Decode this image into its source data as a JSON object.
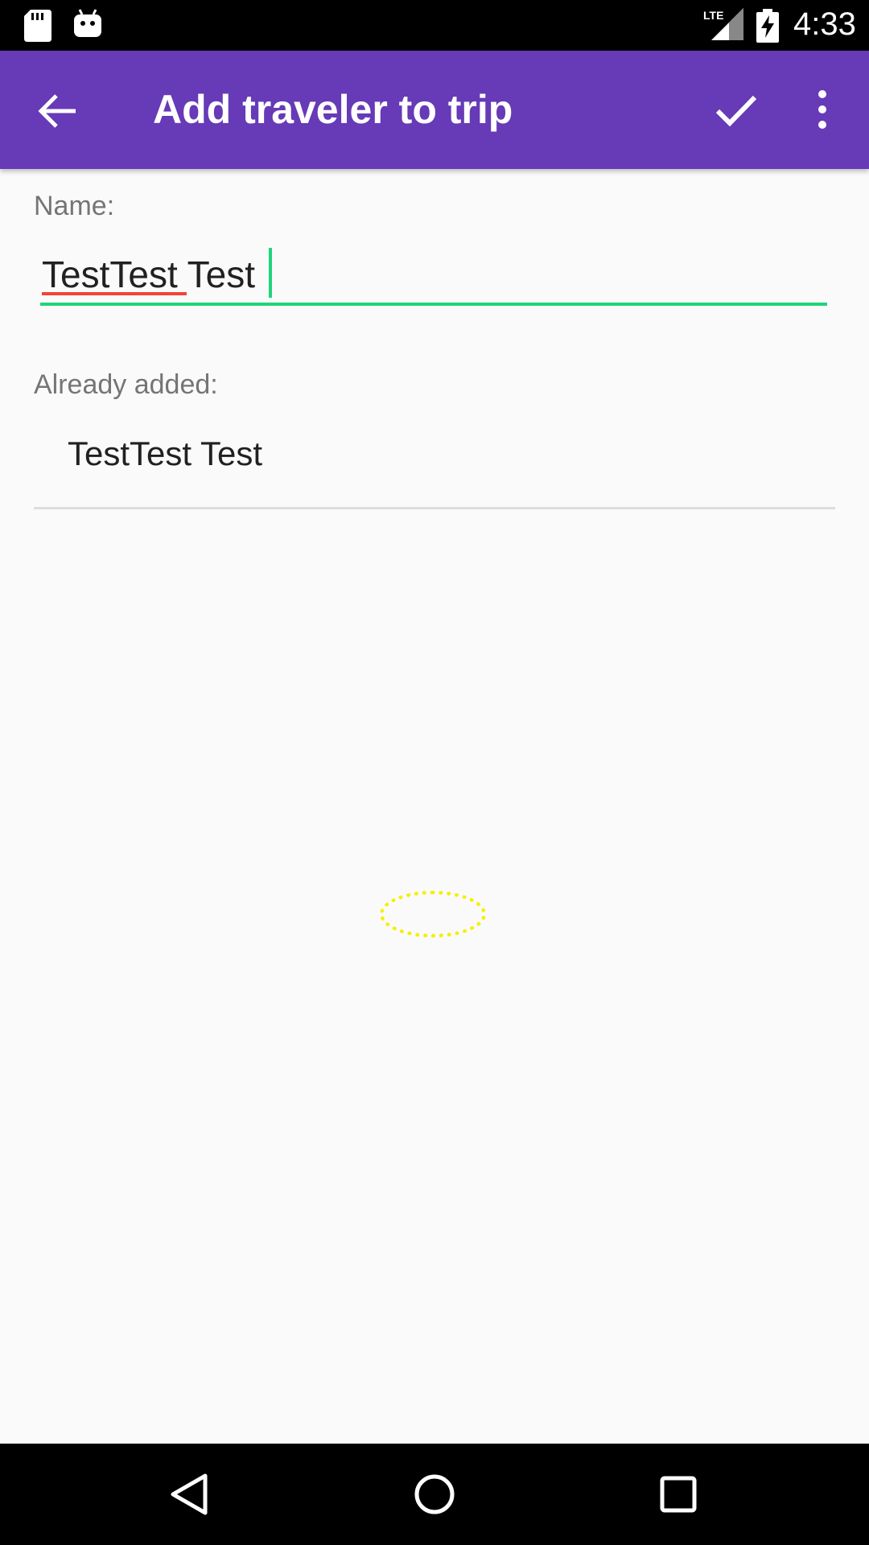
{
  "status_bar": {
    "network": "LTE",
    "time": "4:33",
    "icons": [
      "sd-card-icon",
      "android-icon",
      "lte-signal-icon",
      "battery-charging-icon"
    ]
  },
  "toolbar": {
    "title": "Add traveler to trip",
    "back_icon": "arrow-back-icon",
    "confirm_icon": "check-icon",
    "overflow_icon": "more-vert-icon",
    "background_color": "#673ab7"
  },
  "form": {
    "name_label": "Name:",
    "name_value": "TestTest Test",
    "accent_color": "#1ed57a"
  },
  "already_added": {
    "label": "Already added:",
    "items": [
      "TestTest Test"
    ]
  },
  "nav_bar": {
    "icons": [
      "back-triangle-icon",
      "home-circle-icon",
      "recents-square-icon"
    ]
  }
}
